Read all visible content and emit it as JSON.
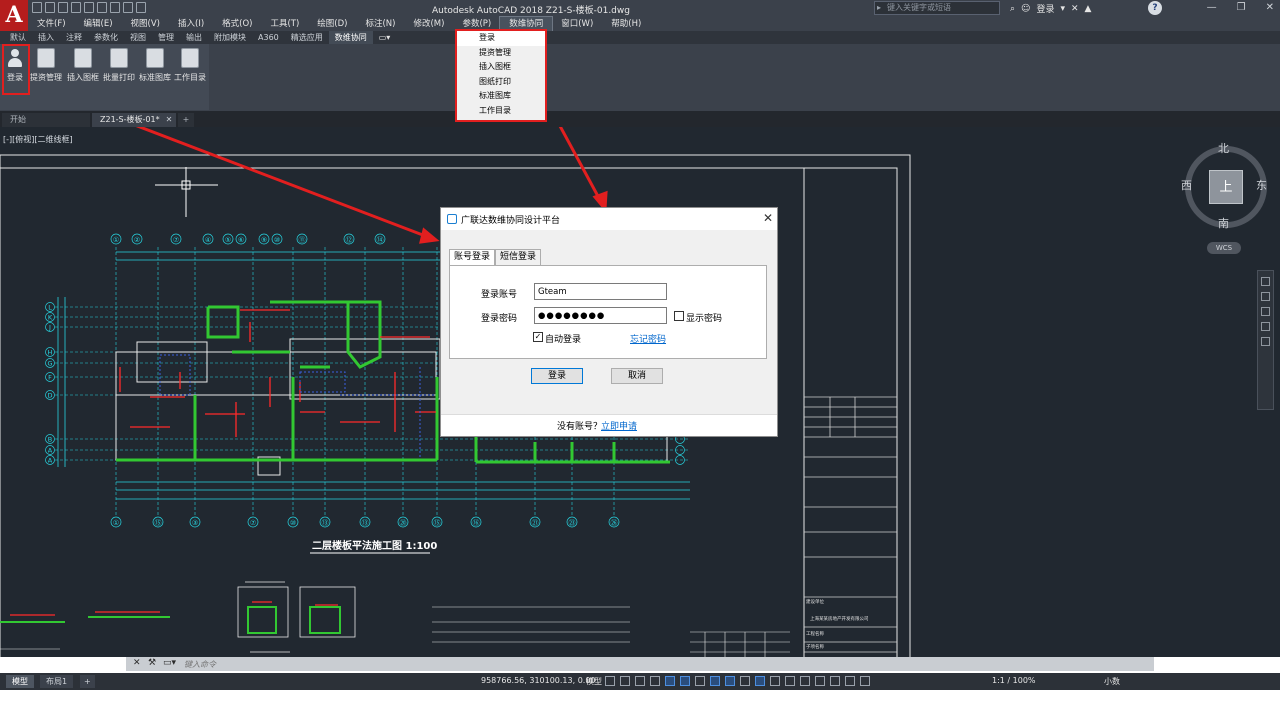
{
  "window": {
    "title": "Autodesk AutoCAD 2018    Z21-S-楼板-01.dwg",
    "search_placeholder": "键入关键字或短语",
    "user": "登录",
    "help": "?"
  },
  "menubar": {
    "items": [
      "文件(F)",
      "编辑(E)",
      "视图(V)",
      "插入(I)",
      "格式(O)",
      "工具(T)",
      "绘图(D)",
      "标注(N)",
      "修改(M)",
      "参数(P)",
      "数维协同",
      "窗口(W)",
      "帮助(H)"
    ],
    "active": "数维协同"
  },
  "ribbon": {
    "tabs": [
      "默认",
      "插入",
      "注释",
      "参数化",
      "视图",
      "管理",
      "输出",
      "附加模块",
      "A360",
      "精选应用",
      "数维协同"
    ],
    "active_tab": "数维协同",
    "buttons": [
      "登录",
      "提资管理",
      "插入图框",
      "批量打印",
      "标准图库",
      "工作目录"
    ]
  },
  "file_tabs": {
    "start": "开始",
    "current": "Z21-S-楼板-01*"
  },
  "viewport": {
    "label": "[-][俯视][二维线框]"
  },
  "drawing": {
    "plan_title": "二层楼板平法施工图 1:100",
    "top_axis_labels": [
      "①",
      "②",
      "⑦",
      "④",
      "⑤",
      "⑥",
      "⑨",
      "⑩",
      "⑪",
      "⑫",
      "⑭"
    ],
    "bottom_axis_labels": [
      "①",
      "⑮",
      "③",
      "⑦",
      "⑩",
      "⑬",
      "⑬",
      "⑳",
      "⑮",
      "⑯",
      "㉑",
      "㉓",
      "㉖"
    ],
    "left_axis_labels": [
      "L",
      "K",
      "J",
      "H",
      "G",
      "F",
      "D",
      "B",
      "A",
      "A"
    ],
    "title_block_lines": [
      "建设单位",
      "工程名称",
      "上海某某房地产开发有限公司",
      "子项名称"
    ]
  },
  "viewcube": {
    "north": "北",
    "south": "南",
    "west": "西",
    "east": "东",
    "face": "上",
    "wcs": "WCS"
  },
  "dropdown": {
    "items": [
      "登录",
      "提资管理",
      "插入图框",
      "图纸打印",
      "标准图库",
      "工作目录"
    ]
  },
  "dialog": {
    "title": "广联达数维协同设计平台",
    "tabs": [
      "账号登录",
      "短信登录"
    ],
    "active_tab": "账号登录",
    "account_label": "登录账号",
    "account_value": "Gteam",
    "password_label": "登录密码",
    "password_value": "●●●●●●●●",
    "show_password_label": "显示密码",
    "show_password_checked": false,
    "auto_login_label": "自动登录",
    "auto_login_checked": true,
    "forgot_password": "忘记密码",
    "login_button": "登录",
    "cancel_button": "取消",
    "no_account_text": "没有账号？",
    "apply_link": "立即申请"
  },
  "command_line": {
    "placeholder": "键入命令"
  },
  "statusbar": {
    "layout_tabs": [
      "模型",
      "布局1",
      "+"
    ],
    "coords": "958766.56, 310100.13, 0.00",
    "model": "模型",
    "scale": "1:1 / 100%",
    "units": "小数"
  },
  "annotation_color": "#e21f1f"
}
